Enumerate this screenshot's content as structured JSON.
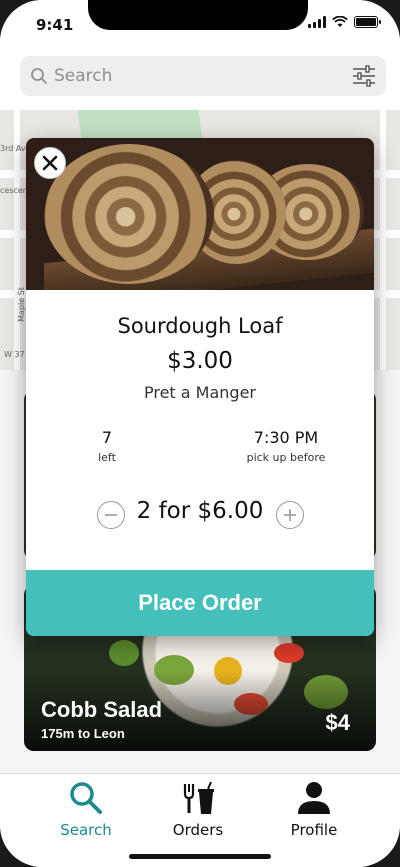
{
  "status_bar": {
    "time": "9:41"
  },
  "search": {
    "placeholder": "Search",
    "icon": "magnifier-icon",
    "filter_icon": "sliders-icon"
  },
  "map": {
    "labels": [
      "3rd Av",
      "cescen",
      "Maple St",
      "W 37"
    ]
  },
  "product": {
    "name": "Sourdough Loaf",
    "price": "$3.00",
    "store": "Pret a Manger",
    "stock_count": "7",
    "stock_label": "left",
    "pickup_time": "7:30 PM",
    "pickup_label": "pick up before",
    "quantity_text": "2 for $6.00",
    "order_button": "Place Order"
  },
  "background_listing": {
    "name": "Cobb Salad",
    "distance": "175m to Leon",
    "price": "$4"
  },
  "tabs": [
    {
      "label": "Search",
      "icon": "search-icon",
      "active": true
    },
    {
      "label": "Orders",
      "icon": "fork-cup-icon",
      "active": false
    },
    {
      "label": "Profile",
      "icon": "person-icon",
      "active": false
    }
  ],
  "colors": {
    "accent": "#44bfba",
    "active_tab": "#1f8a8d"
  }
}
